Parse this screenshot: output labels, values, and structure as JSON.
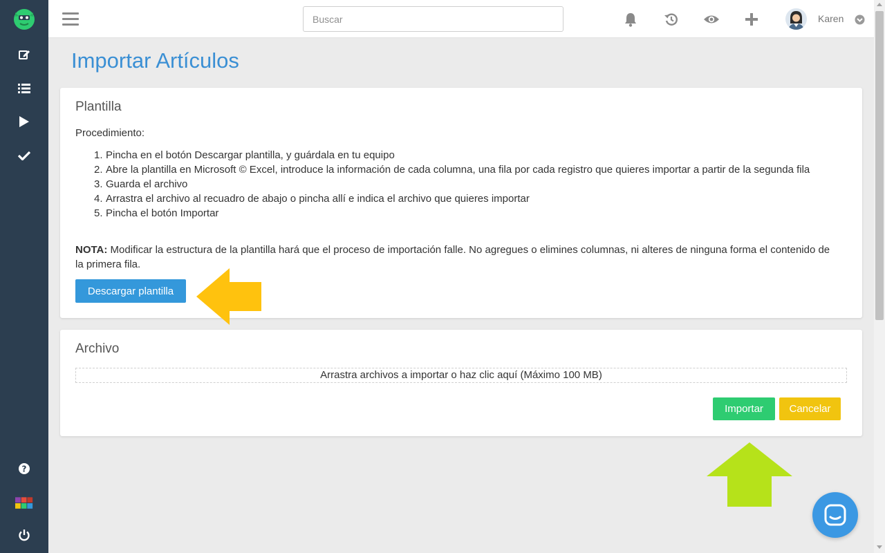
{
  "topbar": {
    "search_placeholder": "Buscar",
    "user_name": "Karen"
  },
  "page": {
    "title": "Importar Artículos"
  },
  "plantilla": {
    "title": "Plantilla",
    "procedure_label": "Procedimiento:",
    "steps": [
      {
        "num": "1.",
        "text": "Pincha en el botón Descargar plantilla, y guárdala en tu equipo"
      },
      {
        "num": "2.",
        "text": "Abre la plantilla en Microsoft © Excel, introduce la información de cada columna, una fila por cada registro que quieres importar a partir de la segunda fila"
      },
      {
        "num": "3.",
        "text": "Guarda el archivo"
      },
      {
        "num": "4.",
        "text": "Arrastra el archivo al recuadro de abajo o pincha allí e indica el archivo que quieres importar"
      },
      {
        "num": "5.",
        "text": "Pincha el botón Importar"
      }
    ],
    "note_label": "NOTA:",
    "note_text": " Modificar la estructura de la plantilla hará que el proceso de importación falle. No agregues o elimines columnas, ni alteres de ninguna forma el contenido de la primera fila.",
    "download_button": "Descargar plantilla"
  },
  "archivo": {
    "title": "Archivo",
    "dropzone_text": "Arrastra archivos a importar o haz clic aquí (Máximo 100 MB)",
    "import_button": "Importar",
    "cancel_button": "Cancelar"
  },
  "colors": {
    "sidebar": "#2c3e50",
    "title_blue": "#3a8fd4",
    "download_blue": "#3498db",
    "import_green": "#2ecc71",
    "cancel_yellow": "#f1c40f",
    "arrow_yellow": "#ffc20e",
    "arrow_lime": "#b6e21a",
    "chat_blue": "#3b98e3"
  },
  "icons": {
    "sidebar": [
      "edit-icon",
      "list-icon",
      "play-icon",
      "check-icon",
      "help-icon",
      "apps-grid-icon",
      "power-icon"
    ],
    "topbar": [
      "bell-icon",
      "history-icon",
      "eye-icon",
      "plus-icon"
    ]
  }
}
